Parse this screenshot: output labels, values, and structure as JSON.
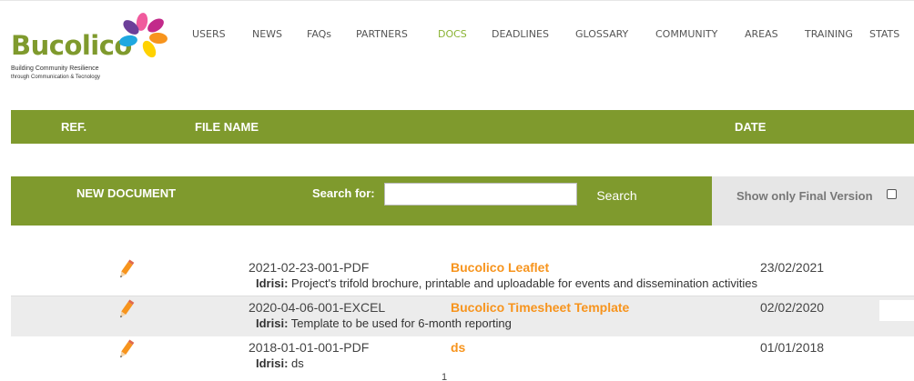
{
  "logo": {
    "name": "Bucolico",
    "tagline_line1": "Building Community Resilience",
    "tagline_line2": "through Communication & Tecnology"
  },
  "nav": {
    "items": [
      "USERS",
      "NEWS",
      "FAQs",
      "PARTNERS",
      "DOCS",
      "DEADLINES",
      "GLOSSARY",
      "COMMUNITY",
      "AREAS",
      "TRAINING",
      "STATS"
    ],
    "active": "DOCS"
  },
  "table_header": {
    "ref": "REF.",
    "file_name": "FILE NAME",
    "date": "DATE"
  },
  "toolbar": {
    "new_document": "NEW DOCUMENT",
    "search_label": "Search for:",
    "search_value": "",
    "search_button": "Search",
    "final_version_label": "Show only Final Version",
    "final_version_checked": false
  },
  "documents": [
    {
      "ref": "2021-02-23-001-PDF",
      "name": "Bucolico Leaflet",
      "date": "23/02/2021",
      "author": "Idrisi:",
      "description": "Project's trifold brochure, printable and uploadable for events and dissemination activities"
    },
    {
      "ref": "2020-04-06-001-EXCEL",
      "name": "Bucolico Timesheet Template",
      "date": "02/02/2020",
      "author": "Idrisi:",
      "description": "Template to be used for 6-month reporting"
    },
    {
      "ref": "2018-01-01-001-PDF",
      "name": "ds",
      "date": "01/01/2018",
      "author": "Idrisi:",
      "description": "ds"
    }
  ],
  "pagination": {
    "current": "1"
  },
  "colors": {
    "brand_green": "#7f9a2d",
    "nav_active": "#8ab333",
    "link_orange": "#f7941d",
    "row_alt": "#ececec"
  },
  "icons": {
    "edit": "pencil-icon",
    "checkbox": "checkbox-icon"
  }
}
